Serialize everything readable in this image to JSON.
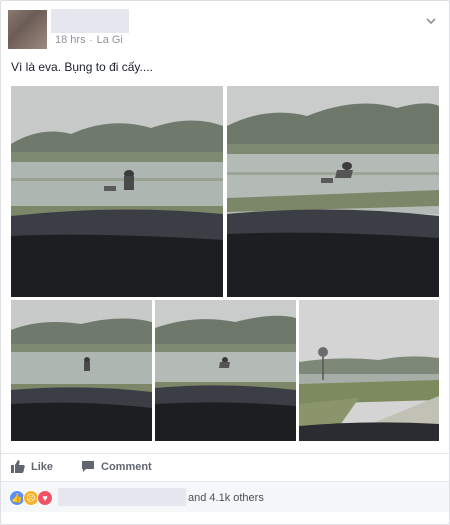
{
  "post": {
    "time": "18 hrs",
    "separator": "·",
    "location": "La Gi",
    "caption": "Vì là eva. Bụng to đi cấy...."
  },
  "actions": {
    "like_label": "Like",
    "comment_label": "Comment"
  },
  "reactions": {
    "icons": [
      "like-icon",
      "sad-icon",
      "love-icon"
    ],
    "others_text": "and 4.1k others"
  },
  "colors": {
    "like_blue": "#5890ff",
    "sad_yellow": "#f7b125",
    "love_red": "#f25268",
    "meta_gray": "#90949c"
  }
}
